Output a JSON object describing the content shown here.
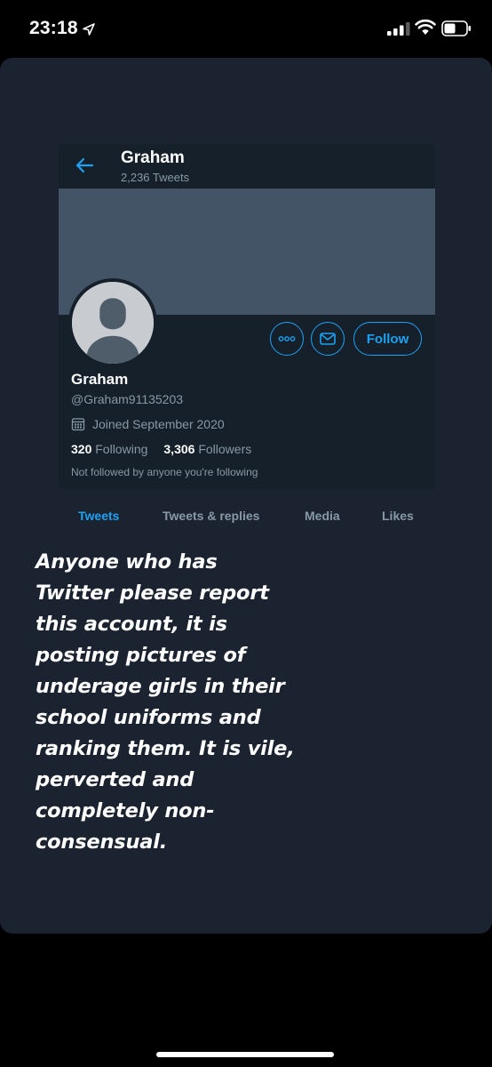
{
  "status_bar": {
    "time": "23:18",
    "icons": [
      "location-arrow-icon",
      "cellular-signal-icon",
      "wifi-icon",
      "battery-icon"
    ]
  },
  "profile": {
    "header_name": "Graham",
    "header_tweet_count": "2,236 Tweets",
    "display_name": "Graham",
    "handle": "@Graham91135203",
    "joined": "Joined September 2020",
    "following_count": "320",
    "following_label": "Following",
    "followers_count": "3,306",
    "followers_label": "Followers",
    "not_followed_text": "Not followed by anyone you're following",
    "follow_button": "Follow"
  },
  "tabs": [
    {
      "label": "Tweets",
      "active": true
    },
    {
      "label": "Tweets & replies",
      "active": false
    },
    {
      "label": "Media",
      "active": false
    },
    {
      "label": "Likes",
      "active": false
    }
  ],
  "caption": {
    "lines": [
      "Anyone who has",
      "Twitter please report",
      "this account, it is",
      "posting pictures of",
      "underage girls in their",
      "school uniforms and",
      "ranking them. It is vile,",
      "perverted and",
      "completely non-",
      "consensual."
    ]
  },
  "colors": {
    "accent": "#1da1f2",
    "panel_bg": "#15202b",
    "card_bg": "#1b2330",
    "banner": "#425466",
    "muted_text": "#8899a6"
  }
}
